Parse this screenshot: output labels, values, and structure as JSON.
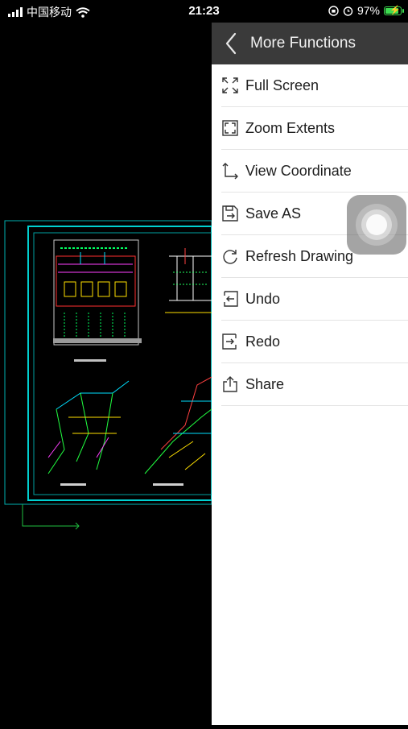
{
  "status_bar": {
    "carrier": "中国移动",
    "time": "21:23",
    "battery_percent": "97%",
    "battery_level": 0.97
  },
  "panel": {
    "title": "More Functions",
    "back_icon": "chevron-left-icon",
    "items": [
      {
        "label": "Full Screen",
        "icon": "full-screen-icon"
      },
      {
        "label": "Zoom Extents",
        "icon": "zoom-extents-icon"
      },
      {
        "label": "View Coordinate",
        "icon": "coordinate-icon"
      },
      {
        "label": "Save AS",
        "icon": "save-as-icon"
      },
      {
        "label": "Refresh Drawing",
        "icon": "refresh-icon"
      },
      {
        "label": "Undo",
        "icon": "undo-icon"
      },
      {
        "label": "Redo",
        "icon": "redo-icon"
      },
      {
        "label": "Share",
        "icon": "share-icon"
      }
    ]
  },
  "colors": {
    "panel_header": "#3a3a3a",
    "drawing_border": "#00c8c8",
    "battery": "#3ddc50"
  }
}
